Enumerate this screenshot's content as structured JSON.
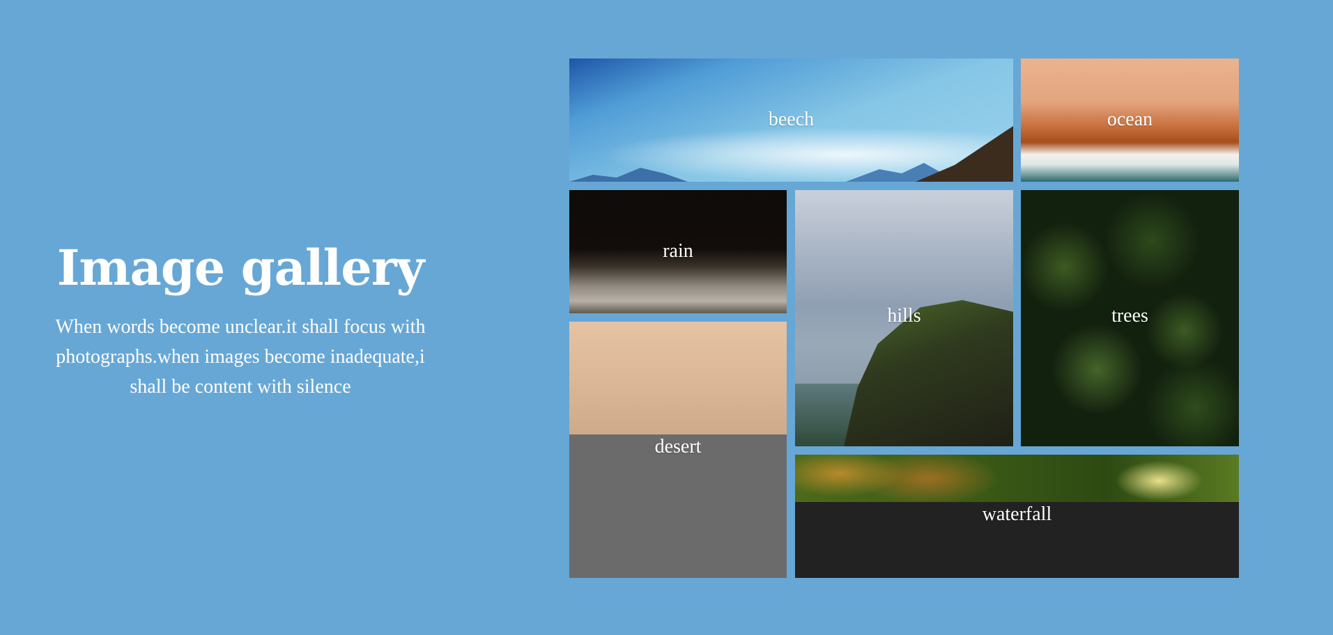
{
  "intro": {
    "title": "Image gallery",
    "description": "When words become unclear.it shall focus with photographs.when images become inadequate,i shall be content with silence"
  },
  "gallery": {
    "tiles": [
      {
        "label": "beech"
      },
      {
        "label": "ocean"
      },
      {
        "label": "rain"
      },
      {
        "label": "hills"
      },
      {
        "label": "trees"
      },
      {
        "label": "desert"
      },
      {
        "label": "waterfall"
      }
    ]
  },
  "colors": {
    "background": "#67a7d5",
    "text": "#ffffff"
  }
}
